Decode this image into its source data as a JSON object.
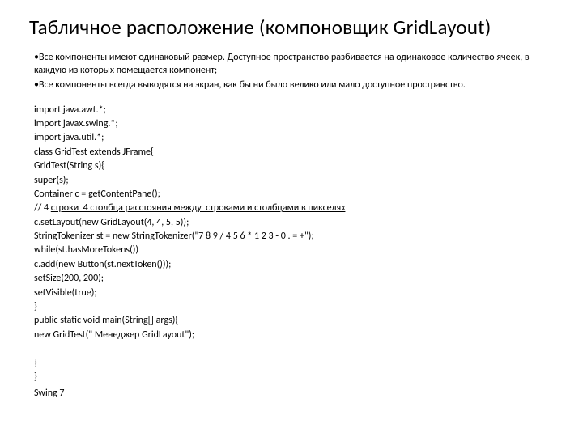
{
  "title": "Табличное расположение (компоновщик GridLayout)",
  "bullets": [
    "•Все компоненты имеют одинаковый размер. Доступное пространство  разбивается на одинаковое количество ячеек, в каждую из которых помещается компонент;",
    "•Все компоненты всегда выводятся на экран, как бы ни было велико или мало доступное пространство."
  ],
  "code": {
    "l1": "import java.awt.*;",
    "l2": "import javax.swing.*;",
    "l3": "import java.util.*;",
    "l4a": "class GridTest extends JFrame",
    "l4b": "{",
    "l5": "GridTest(String s){",
    "l6": "super(s);",
    "l7": "Container c = getContentPane();",
    "l8a": "// 4 ",
    "l8b": "строки  4 столбца расстояния между  строками и столбцами в пикселях",
    "l9": "c.setLayout(new GridLayout(4, 4, 5, 5));",
    "l10": "StringTokenizer st = new StringTokenizer(\"7 8 9 / 4 5 6 * 1 2 3 - 0 . = +\");",
    "l11": "while(st.hasMoreTokens())",
    "l12": "c.add(new Button(st.nextToken()));",
    "l13": "setSize(200, 200);",
    "l14": "setVisible(true);",
    "l15": "}",
    "l16": "public static void main(String[] args){",
    "l17": "new GridTest(\" Менеджер GridLayout\");",
    "l18": " ",
    "l19": "}",
    "l20": "}"
  },
  "footer": "Swing 7"
}
